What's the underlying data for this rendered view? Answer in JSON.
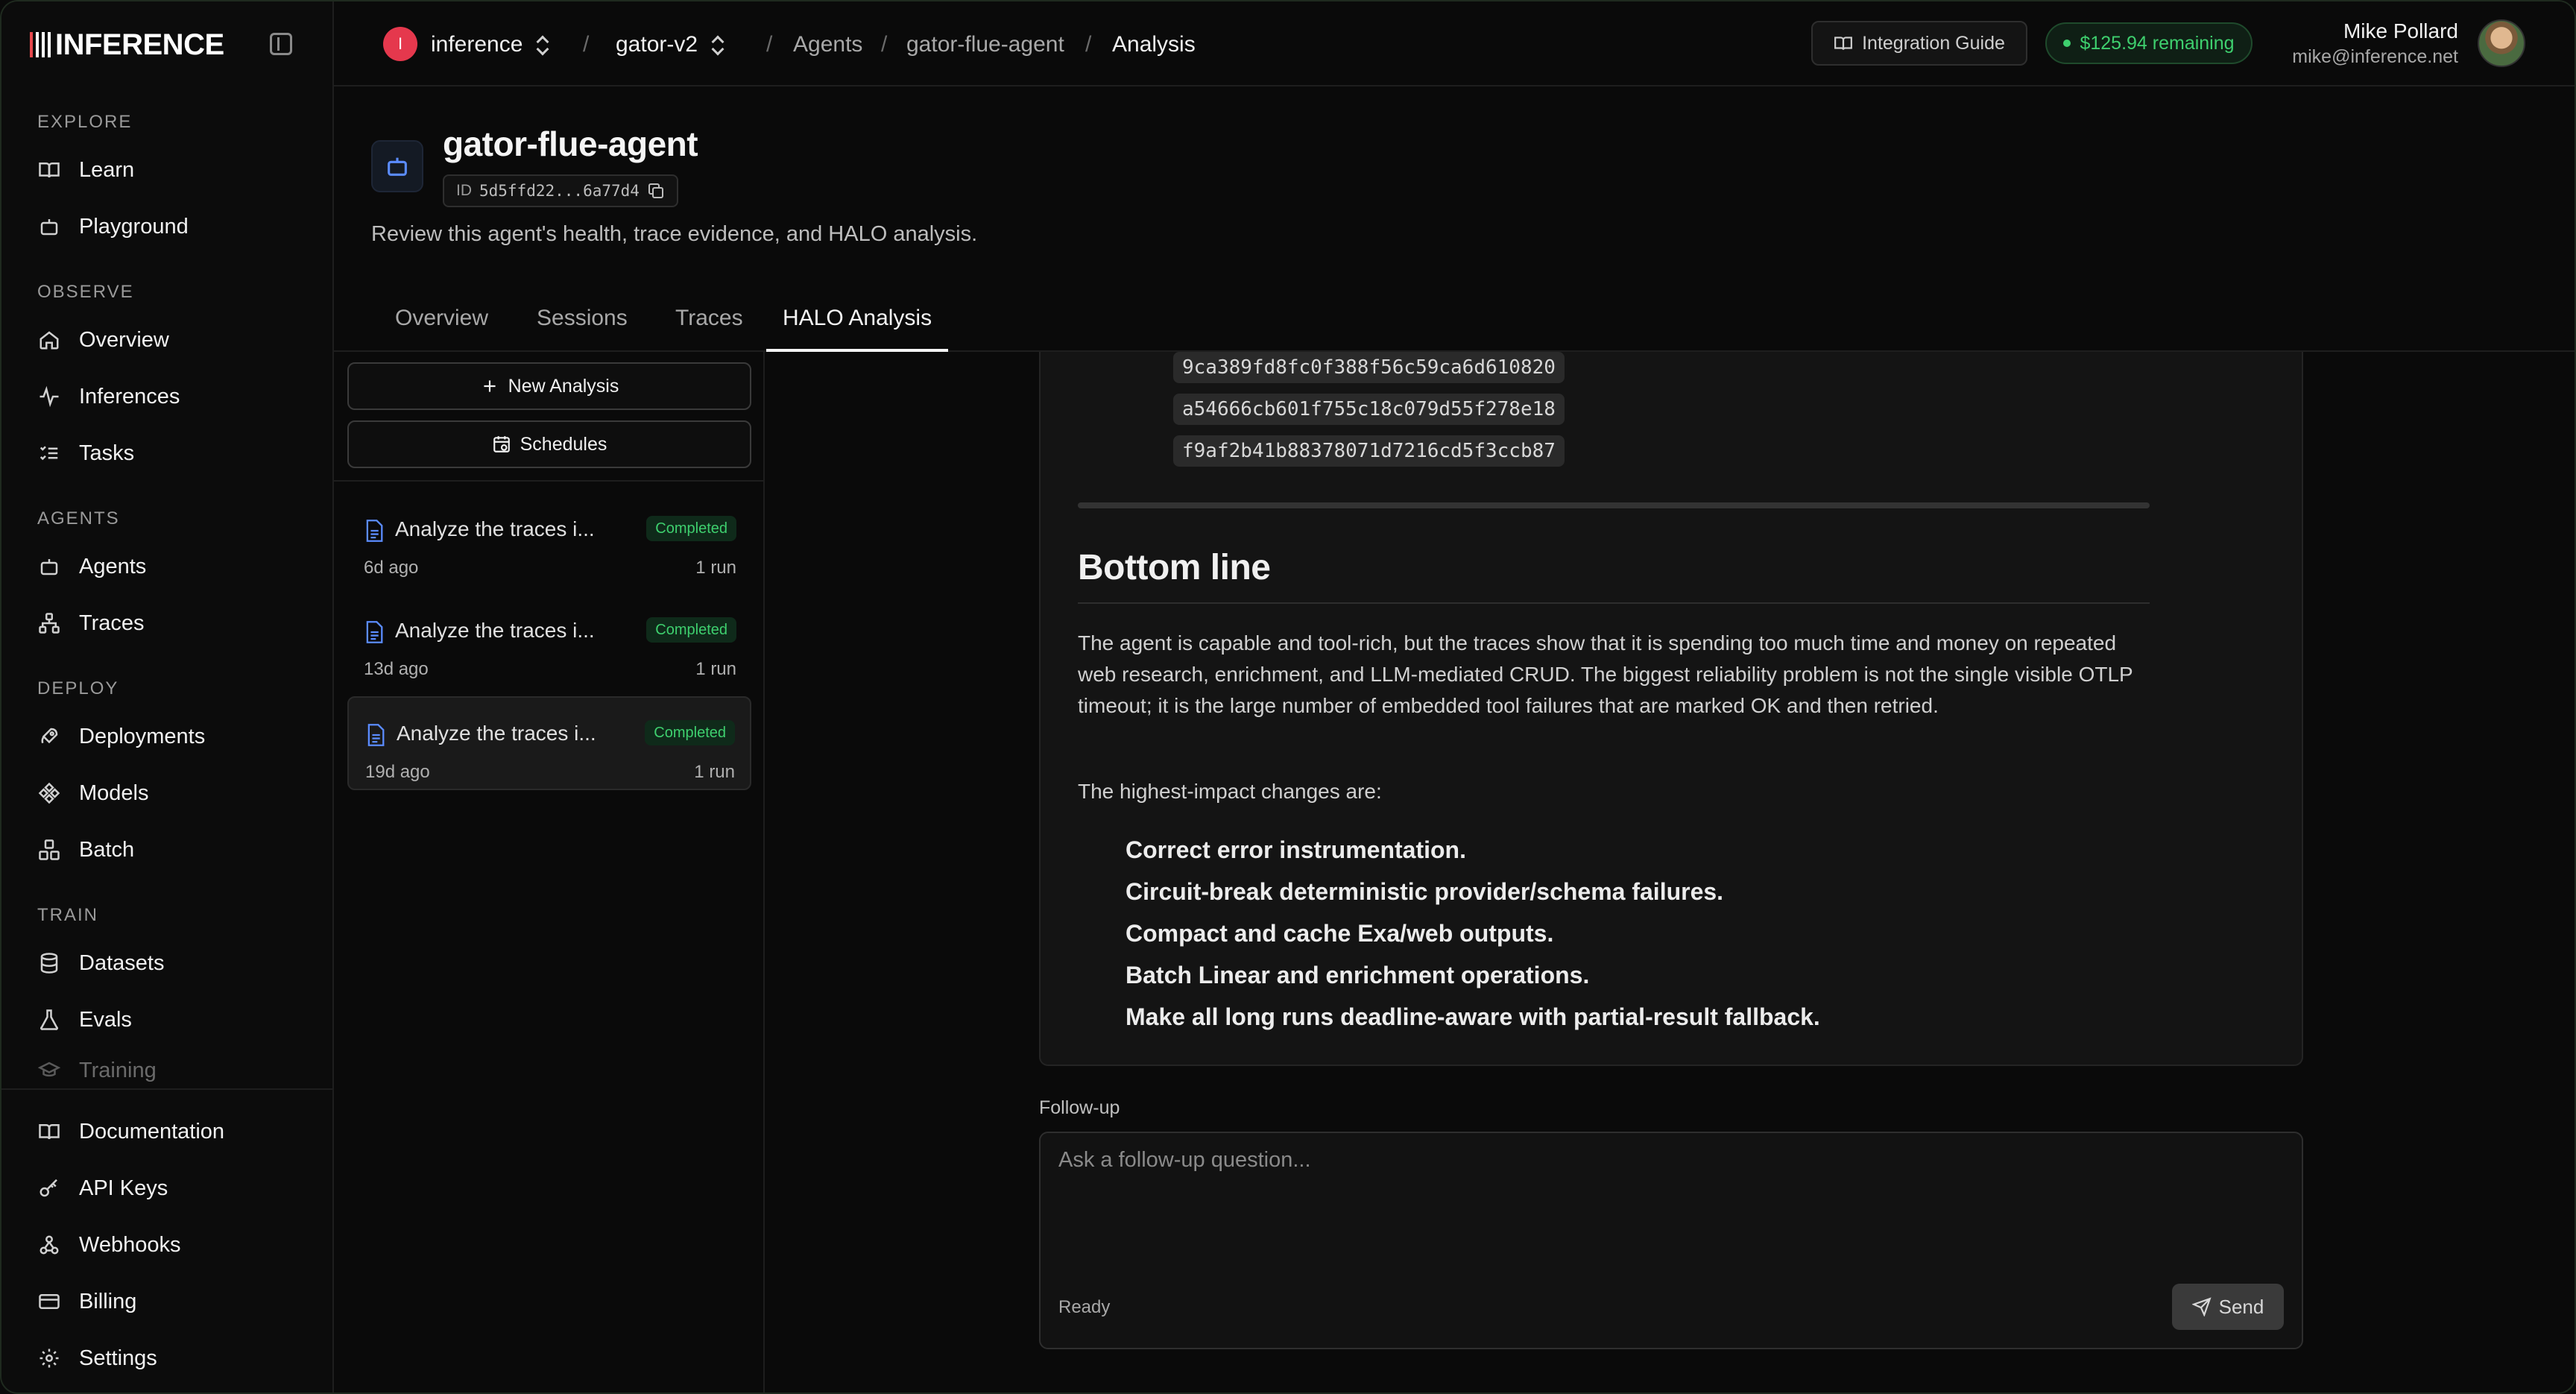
{
  "brand": {
    "name": "INFERENCE",
    "accent": "#e5484d"
  },
  "sidebar": {
    "sections": {
      "explore": "EXPLORE",
      "observe": "OBSERVE",
      "agents": "AGENTS",
      "deploy": "DEPLOY",
      "train": "TRAIN"
    },
    "items": {
      "learn": "Learn",
      "playground": "Playground",
      "overview": "Overview",
      "inferences": "Inferences",
      "tasks": "Tasks",
      "agents": "Agents",
      "traces": "Traces",
      "deployments": "Deployments",
      "models": "Models",
      "batch": "Batch",
      "datasets": "Datasets",
      "evals": "Evals",
      "training": "Training",
      "documentation": "Documentation",
      "api_keys": "API Keys",
      "webhooks": "Webhooks",
      "billing": "Billing",
      "settings": "Settings"
    }
  },
  "topbar": {
    "org_initial": "I",
    "org": "inference",
    "project": "gator-v2",
    "sep": "/",
    "crumbs": [
      "Agents",
      "gator-flue-agent",
      "Analysis"
    ],
    "integration_guide": "Integration Guide",
    "credits": "$125.94 remaining",
    "credits_color": "#3ecf6e",
    "user_name": "Mike Pollard",
    "user_email": "mike@inference.net"
  },
  "agent": {
    "title": "gator-flue-agent",
    "id_label": "ID",
    "id_value": "5d5ffd22...6a77d4",
    "description": "Review this agent's health, trace evidence, and HALO analysis."
  },
  "tabs": [
    "Overview",
    "Sessions",
    "Traces",
    "HALO Analysis"
  ],
  "list": {
    "new_analysis": "New Analysis",
    "schedules": "Schedules",
    "runs": [
      {
        "name": "Analyze the traces i...",
        "status": "Completed",
        "ago": "6d ago",
        "runs": "1 run"
      },
      {
        "name": "Analyze the traces i...",
        "status": "Completed",
        "ago": "13d ago",
        "runs": "1 run"
      },
      {
        "name": "Analyze the traces i...",
        "status": "Completed",
        "ago": "19d ago",
        "runs": "1 run"
      }
    ]
  },
  "report": {
    "hashes": [
      "9ca389fd8fc0f388f56c59ca6d610820",
      "a54666cb601f755c18c079d55f278e18",
      "f9af2b41b88378071d7216cd5f3ccb87"
    ],
    "heading": "Bottom line",
    "paragraph": "The agent is capable and tool-rich, but the traces show that it is spending too much time and money on repeated web research, enrichment, and LLM-mediated CRUD. The biggest reliability problem is not the single visible OTLP timeout; it is the large number of embedded tool failures that are marked OK and then retried.",
    "lead": "The highest-impact changes are:",
    "bullets": [
      "Correct error instrumentation.",
      "Circuit-break deterministic provider/schema failures.",
      "Compact and cache Exa/web outputs.",
      "Batch Linear and enrichment operations.",
      "Make all long runs deadline-aware with partial-result fallback."
    ]
  },
  "followup": {
    "label": "Follow-up",
    "placeholder": "Ask a follow-up question...",
    "status": "Ready",
    "send": "Send"
  }
}
